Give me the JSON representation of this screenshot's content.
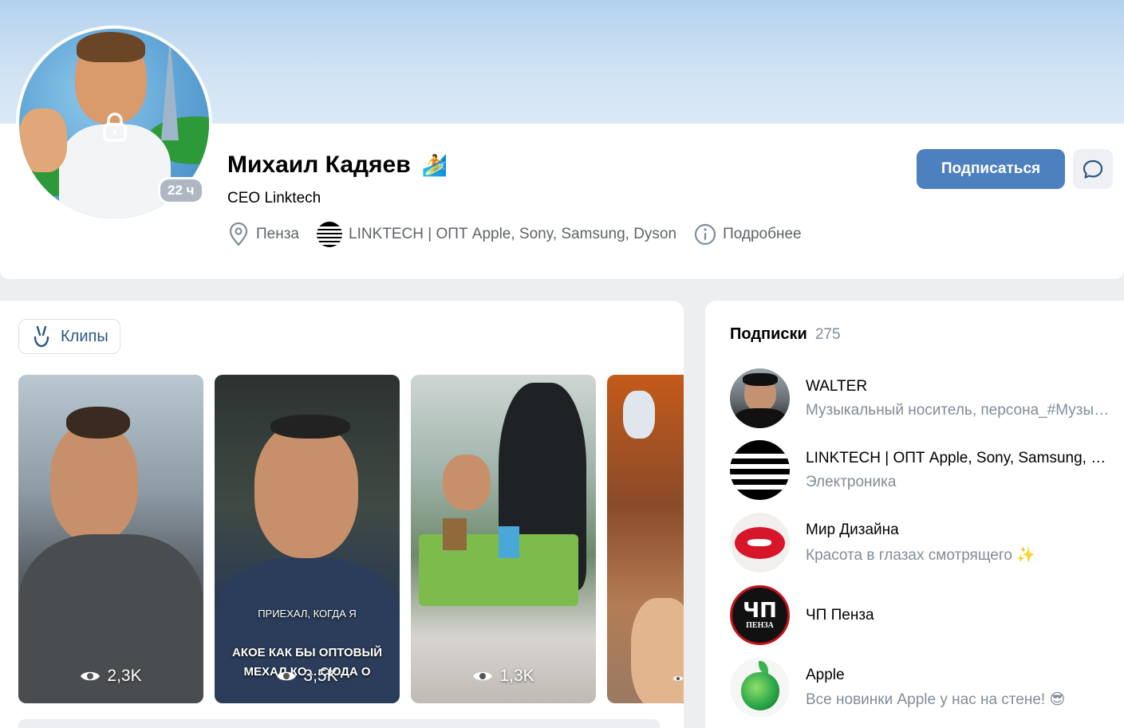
{
  "profile": {
    "name": "Михаил Кадяев",
    "status_emoji": "🏄",
    "occupation": "CEO Linktech",
    "last_seen": "22 ч",
    "city": "Пенза",
    "workplace": "LINKTECH | ОПТ Apple, Sony, Samsung, Dyson",
    "more_label": "Подробнее",
    "subscribe_label": "Подписаться"
  },
  "clips": {
    "tab_label": "Клипы",
    "items": [
      {
        "views": "2,3K"
      },
      {
        "views": "3,5K",
        "caption_top": "ПРИЕХАЛ, КОГДА Я",
        "caption_mid": "АКОЕ КАК БЫ ОПТОВЫЙ",
        "caption_bottom": "МЕХАЛ КО... СЮДА О"
      },
      {
        "views": "1,3K"
      },
      {
        "views": ""
      }
    ]
  },
  "subscriptions": {
    "title": "Подписки",
    "count": "275",
    "items": [
      {
        "name": "WALTER",
        "desc": "Музыкальный носитель, персона_#Музыкальный"
      },
      {
        "name": "LINKTECH | ОПТ Apple, Sony, Samsung, Dyson",
        "desc": "Электроника"
      },
      {
        "name": "Мир Дизайна",
        "desc": "Красота в глазах смотрящего ✨"
      },
      {
        "name": "ЧП Пенза",
        "desc": ""
      },
      {
        "name": "Apple",
        "desc": "Все новинки Apple у нас на стене! 😎"
      }
    ],
    "chp_logo_text": "ЧП",
    "chp_logo_sub": "ПЕНЗА"
  },
  "colors": {
    "accent": "#4d80be",
    "link": "#2a5885",
    "secondary_text": "#818c99"
  }
}
